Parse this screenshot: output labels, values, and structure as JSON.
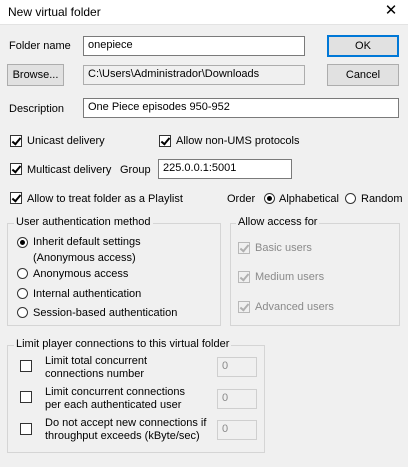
{
  "window": {
    "title": "New virtual folder",
    "close_glyph": "✕"
  },
  "folder_name": {
    "label": "Folder name",
    "value": "onepiece"
  },
  "buttons": {
    "ok": "OK",
    "cancel": "Cancel",
    "browse": "Browse..."
  },
  "path": {
    "value": "C:\\Users\\Administrador\\Downloads"
  },
  "description": {
    "label": "Description",
    "value": "One Piece episodes 950-952"
  },
  "delivery": {
    "unicast": "Unicast delivery",
    "allow_non_ums": "Allow non-UMS protocols",
    "multicast": "Multicast delivery",
    "group_label": "Group",
    "group_value": "225.0.0.1:5001"
  },
  "playlist": {
    "label": "Allow to treat folder as a Playlist"
  },
  "order": {
    "label": "Order",
    "alphabetical": "Alphabetical",
    "random": "Random"
  },
  "auth": {
    "title": "User authentication method",
    "inherit_line1": "Inherit default settings",
    "inherit_line2": "(Anonymous access)",
    "anonymous": "Anonymous access",
    "internal": "Internal authentication",
    "session": "Session-based authentication"
  },
  "access": {
    "title": "Allow access for",
    "basic": "Basic users",
    "medium": "Medium users",
    "advanced": "Advanced users"
  },
  "limits": {
    "title": "Limit player connections to this virtual folder",
    "total_line1": "Limit total concurrent",
    "total_line2": "connections number",
    "total_value": "0",
    "per_user_line1": "Limit concurrent connections",
    "per_user_line2": "per each authenticated user",
    "per_user_value": "0",
    "throughput_line1": "Do not accept new connections if",
    "throughput_line2": "throughput exceeds (kByte/sec)",
    "throughput_value": "0"
  }
}
